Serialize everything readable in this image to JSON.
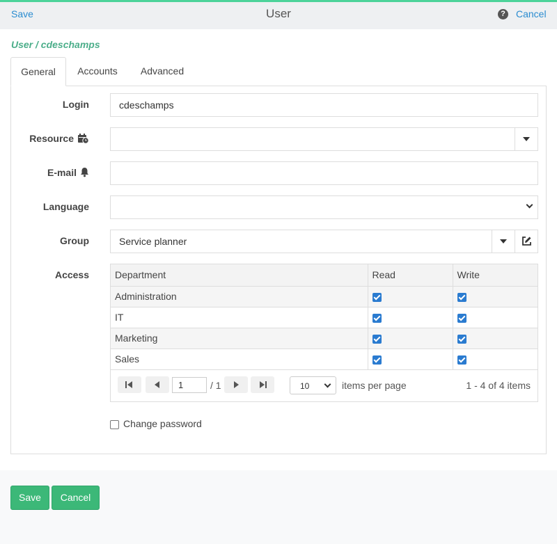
{
  "header": {
    "save_label": "Save",
    "title": "User",
    "help_glyph": "?",
    "cancel_label": "Cancel"
  },
  "breadcrumb": "User / cdeschamps",
  "tabs": [
    {
      "label": "General",
      "active": true
    },
    {
      "label": "Accounts",
      "active": false
    },
    {
      "label": "Advanced",
      "active": false
    }
  ],
  "form": {
    "login": {
      "label": "Login",
      "value": "cdeschamps"
    },
    "resource": {
      "label": "Resource",
      "value": "",
      "icon": "calendar-clock-icon"
    },
    "email": {
      "label": "E-mail",
      "value": "",
      "icon": "bell-icon"
    },
    "language": {
      "label": "Language",
      "value": ""
    },
    "group": {
      "label": "Group",
      "value": "Service planner"
    },
    "access": {
      "label": "Access"
    }
  },
  "access_grid": {
    "columns": [
      "Department",
      "Read",
      "Write"
    ],
    "rows": [
      {
        "department": "Administration",
        "read": true,
        "write": true
      },
      {
        "department": "IT",
        "read": true,
        "write": true
      },
      {
        "department": "Marketing",
        "read": true,
        "write": true
      },
      {
        "department": "Sales",
        "read": true,
        "write": true
      }
    ],
    "pager": {
      "page": "1",
      "total_pages": "/ 1",
      "page_size": "10",
      "items_per_page_label": "items per page",
      "summary": "1 - 4 of 4 items"
    }
  },
  "change_password": {
    "label": "Change password",
    "checked": false
  },
  "footer": {
    "save_label": "Save",
    "cancel_label": "Cancel"
  },
  "colors": {
    "accent": "#4cd39a",
    "link": "#2a8cd0",
    "button": "#3cb878",
    "checkbox": "#2a7bd0"
  }
}
